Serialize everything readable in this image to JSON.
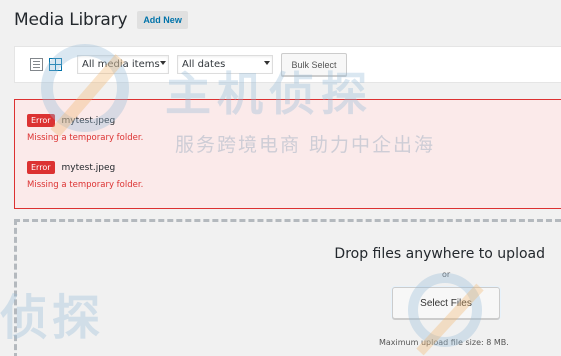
{
  "header": {
    "title": "Media Library",
    "add_new_label": "Add New"
  },
  "toolbar": {
    "filter_items_value": "All media items",
    "filter_dates_value": "All dates",
    "bulk_select_label": "Bulk Select",
    "active_view": "grid"
  },
  "errors": [
    {
      "badge": "Error",
      "filename": "mytest.jpeg",
      "message": "Missing a temporary folder."
    },
    {
      "badge": "Error",
      "filename": "mytest.jpeg",
      "message": "Missing a temporary folder."
    }
  ],
  "upload": {
    "drop_text": "Drop files anywhere to upload",
    "or_text": "or",
    "select_files_label": "Select Files",
    "max_size_text": "Maximum upload file size: 8 MB."
  },
  "watermark": {
    "logo_text": "主机侦探",
    "tagline": "服务跨境电商  助力中企出海",
    "bottom_left_text": "侦探"
  },
  "colors": {
    "accent": "#0073aa",
    "error": "#dc3232",
    "error_bg": "#fbeaea",
    "grid_icon": "#0073aa",
    "list_icon": "#82878c"
  }
}
